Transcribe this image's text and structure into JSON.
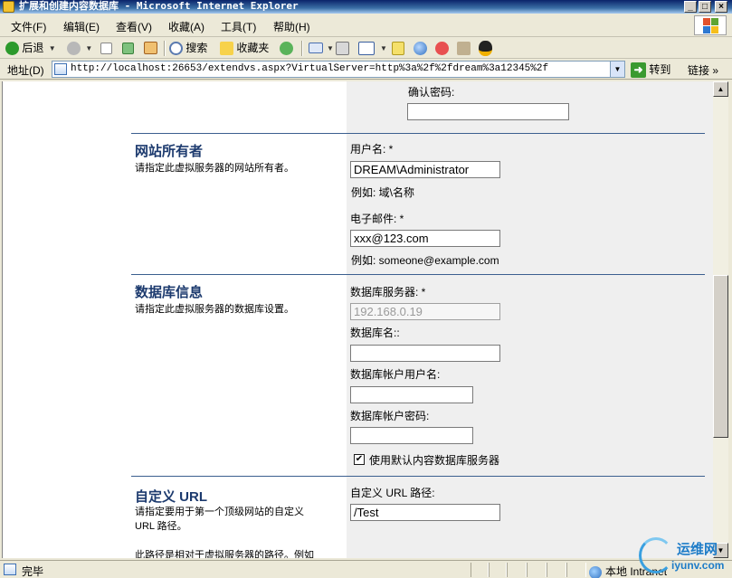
{
  "window": {
    "title": "扩展和创建内容数据库 - Microsoft Internet Explorer",
    "min": "_",
    "max": "□",
    "close": "×"
  },
  "menu": [
    "文件(F)",
    "编辑(E)",
    "查看(V)",
    "收藏(A)",
    "工具(T)",
    "帮助(H)"
  ],
  "toolbar": {
    "back": "后退",
    "search": "搜索",
    "favorites": "收藏夹"
  },
  "address": {
    "label": "地址(D)",
    "url": "http://localhost:26653/extendvs.aspx?VirtualServer=http%3a%2f%2fdream%3a12345%2f",
    "go": "转到",
    "links": "链接"
  },
  "form": {
    "confirm_password": {
      "label": "确认密码:",
      "value": ""
    },
    "owner": {
      "title": "网站所有者",
      "desc": "请指定此虚拟服务器的网站所有者。",
      "username_label": "用户名: *",
      "username_value": "DREAM\\Administrator",
      "username_hint": "例如: 域\\名称",
      "email_label": "电子邮件: *",
      "email_value": "xxx@123.com",
      "email_hint": "例如: someone@example.com"
    },
    "database": {
      "title": "数据库信息",
      "desc": "请指定此虚拟服务器的数据库设置。",
      "server_label": "数据库服务器: *",
      "server_value": "192.168.0.19",
      "name_label": "数据库名::",
      "name_value": "",
      "account_label": "数据库帐户用户名:",
      "account_value": "",
      "password_label": "数据库帐户密码:",
      "password_value": "",
      "use_default_label": "使用默认内容数据库服务器",
      "use_default_checked": true,
      "check_mark": "✔"
    },
    "url": {
      "title": "自定义 URL",
      "desc": "请指定要用于第一个顶级网站的自定义 URL 路径。",
      "desc_more": "此路径是相对于虚拟服务器的路径。例如",
      "path_label": "自定义 URL 路径:",
      "path_value": "/Test"
    }
  },
  "status": {
    "text": "完毕",
    "zone": "本地 Intranet"
  },
  "watermark": {
    "line1": "运维网",
    "line2": "iyunv.com"
  }
}
